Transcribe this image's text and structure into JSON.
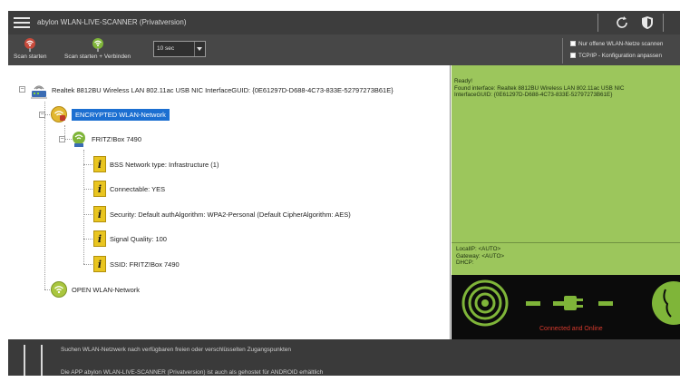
{
  "window": {
    "title": "abylon WLAN-LIVE-SCANNER (Privatversion)"
  },
  "toolbar": {
    "scan_start_label": "Scan starten",
    "scan_connect_label": "Scan starten + Verbinden",
    "interval_value": "10 sec",
    "option_nearby": "Nur offene WLAN-Netze scannen",
    "option_tcpip": "TCP/IP - Konfiguration anpassen"
  },
  "tree": {
    "adapter": "Realtek 8812BU Wireless LAN 802.11ac USB NIC InterfaceGUID: {0E61297D-D688-4C73-833E-52797273B61E}",
    "encrypted_group": "ENCRYPTED WLAN-Network",
    "router": "FRITZ!Box 7490",
    "details": [
      "BSS Network type: Infrastructure (1)",
      "Connectable: YES",
      "Security: Default authAlgorithm: WPA2-Personal (Default CipherAlgorithm: AES)",
      "Signal Quality: 100",
      "SSID: FRITZ!Box 7490"
    ],
    "open_group": "OPEN WLAN-Network"
  },
  "log": {
    "lines": [
      "Ready!",
      "Found interface: Realtek 8812BU Wireless LAN 802.11ac USB NIC",
      "InterfaceGUID: {0E61297D-D688-4C73-833E-52797273B61E}"
    ]
  },
  "network": {
    "localip": "LocalIP:    <AUTO>",
    "gateway": "Gateway:   <AUTO>",
    "dhcp": "DHCP:"
  },
  "status": {
    "text": "Connected and Online"
  },
  "footer": {
    "message": "Suchen WLAN-Netzwerk nach verfügbaren freien oder verschlüsselten Zugangspunkten",
    "message2": "Die APP abylon WLAN-LIVE-SCANNER (Privatversion) ist auch als gehostet für ANDROID erhältlich"
  },
  "colors": {
    "selection": "#1c6fd1",
    "panel_green": "#9cc65c",
    "status_red": "#d83a2d",
    "wifi_green": "#7fb539"
  }
}
